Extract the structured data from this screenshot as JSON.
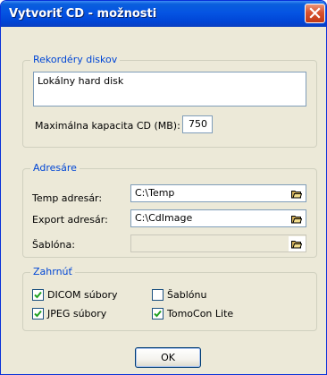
{
  "window": {
    "title": "Vytvoriť CD - možnosti"
  },
  "recorders": {
    "legend": "Rekordéry diskov",
    "list_value": "Lokálny hard disk",
    "capacity_label": "Maximálna kapacita CD (MB):",
    "capacity_value": "750"
  },
  "directories": {
    "legend": "Adresáre",
    "temp_label": "Temp adresár:",
    "temp_value": "C:\\Temp",
    "export_label": "Export adresár:",
    "export_value": "C:\\CdImage",
    "template_label": "Šablóna:",
    "template_value": ""
  },
  "include": {
    "legend": "Zahrnúť",
    "options": [
      {
        "label": "DICOM súbory",
        "checked": true
      },
      {
        "label": "JPEG súbory",
        "checked": true
      },
      {
        "label": "Šablónu",
        "checked": false
      },
      {
        "label": "TomoCon Lite",
        "checked": true
      }
    ]
  },
  "buttons": {
    "ok_label": "OK"
  },
  "icons": {
    "close": "close-icon",
    "folder": "folder-open-icon",
    "check": "checkmark-icon"
  },
  "colors": {
    "titlebar": "#0554e3",
    "close_button": "#d8512f",
    "window_bg": "#ece9d8",
    "legend_text": "#0046d5",
    "checkmark": "#21a121"
  }
}
